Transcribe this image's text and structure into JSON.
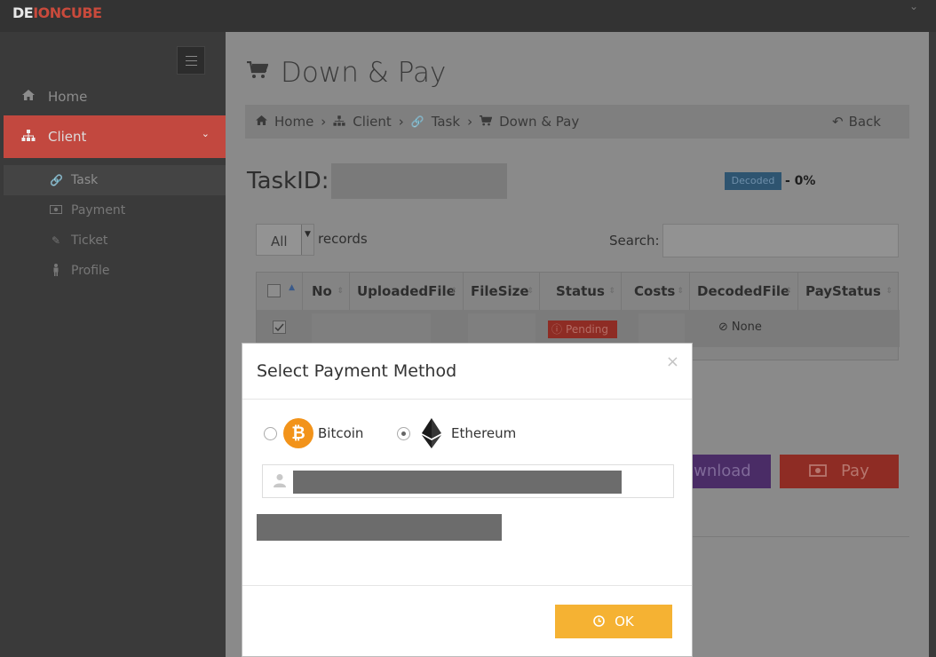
{
  "app": {
    "brand_part1": "DE",
    "brand_part2": "IONCUBE"
  },
  "sidebar": {
    "items": [
      {
        "label": "Home",
        "icon": "home-icon"
      },
      {
        "label": "Client",
        "icon": "sitemap-icon",
        "active": true
      }
    ],
    "subitems": [
      {
        "label": "Task",
        "icon": "link-icon",
        "active": true
      },
      {
        "label": "Payment",
        "icon": "money-icon"
      },
      {
        "label": "Ticket",
        "icon": "edit-icon"
      },
      {
        "label": "Profile",
        "icon": "person-icon"
      }
    ]
  },
  "main": {
    "title": "Down & Pay",
    "breadcrumb": [
      "Home",
      "Client",
      "Task",
      "Down & Pay"
    ],
    "back_label": "Back",
    "task_label": "TaskID:",
    "decoded_badge": "Decoded",
    "percent": "- 0%",
    "length_value": "All",
    "records_label": "records",
    "search_label": "Search:",
    "table": {
      "headers": [
        "No",
        "UploadedFile",
        "FileSize",
        "Status",
        "Costs",
        "DecodedFile",
        "PayStatus"
      ],
      "rows": [
        {
          "status": "Pending",
          "decoded_file": "None"
        }
      ]
    },
    "download_label": "Download",
    "pay_label": "Pay"
  },
  "modal": {
    "title": "Select Payment Method",
    "close": "×",
    "options": [
      {
        "label": "Bitcoin",
        "icon": "bitcoin-icon",
        "checked": false
      },
      {
        "label": "Ethereum",
        "icon": "ethereum-icon",
        "checked": true
      }
    ],
    "ok_label": "OK"
  },
  "colors": {
    "accent_red": "#c2483f",
    "ok_button": "#f5b233",
    "bitcoin": "#f2931a"
  }
}
